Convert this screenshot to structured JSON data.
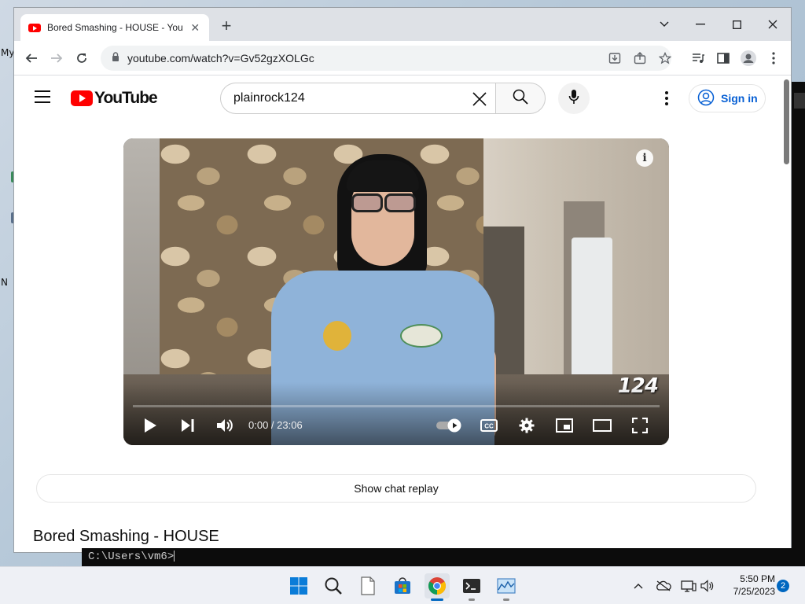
{
  "desktop": {
    "icon_labels": [
      "My",
      "N"
    ]
  },
  "browser": {
    "tab": {
      "title": "Bored Smashing - HOUSE - YouTube"
    },
    "address": {
      "url": "youtube.com/watch?v=Gv52gzXOLGc"
    }
  },
  "youtube": {
    "logo_text": "YouTube",
    "search": {
      "query": "plainrock124"
    },
    "sign_in_label": "Sign in",
    "player": {
      "info_glyph": "i",
      "watermark": "124",
      "time_display": "0:00 / 23:06",
      "progress_fraction": 0
    },
    "chat_replay_label": "Show chat replay",
    "video_title": "Bored Smashing - HOUSE"
  },
  "terminal": {
    "prompt": "C:\\Users\\vm6>"
  },
  "taskbar": {
    "time": "5:50 PM",
    "date": "7/25/2023",
    "notification_count": "2"
  },
  "colors": {
    "youtube_red": "#ff0000",
    "link_blue": "#065fd4",
    "windows_accent": "#0067c0"
  }
}
